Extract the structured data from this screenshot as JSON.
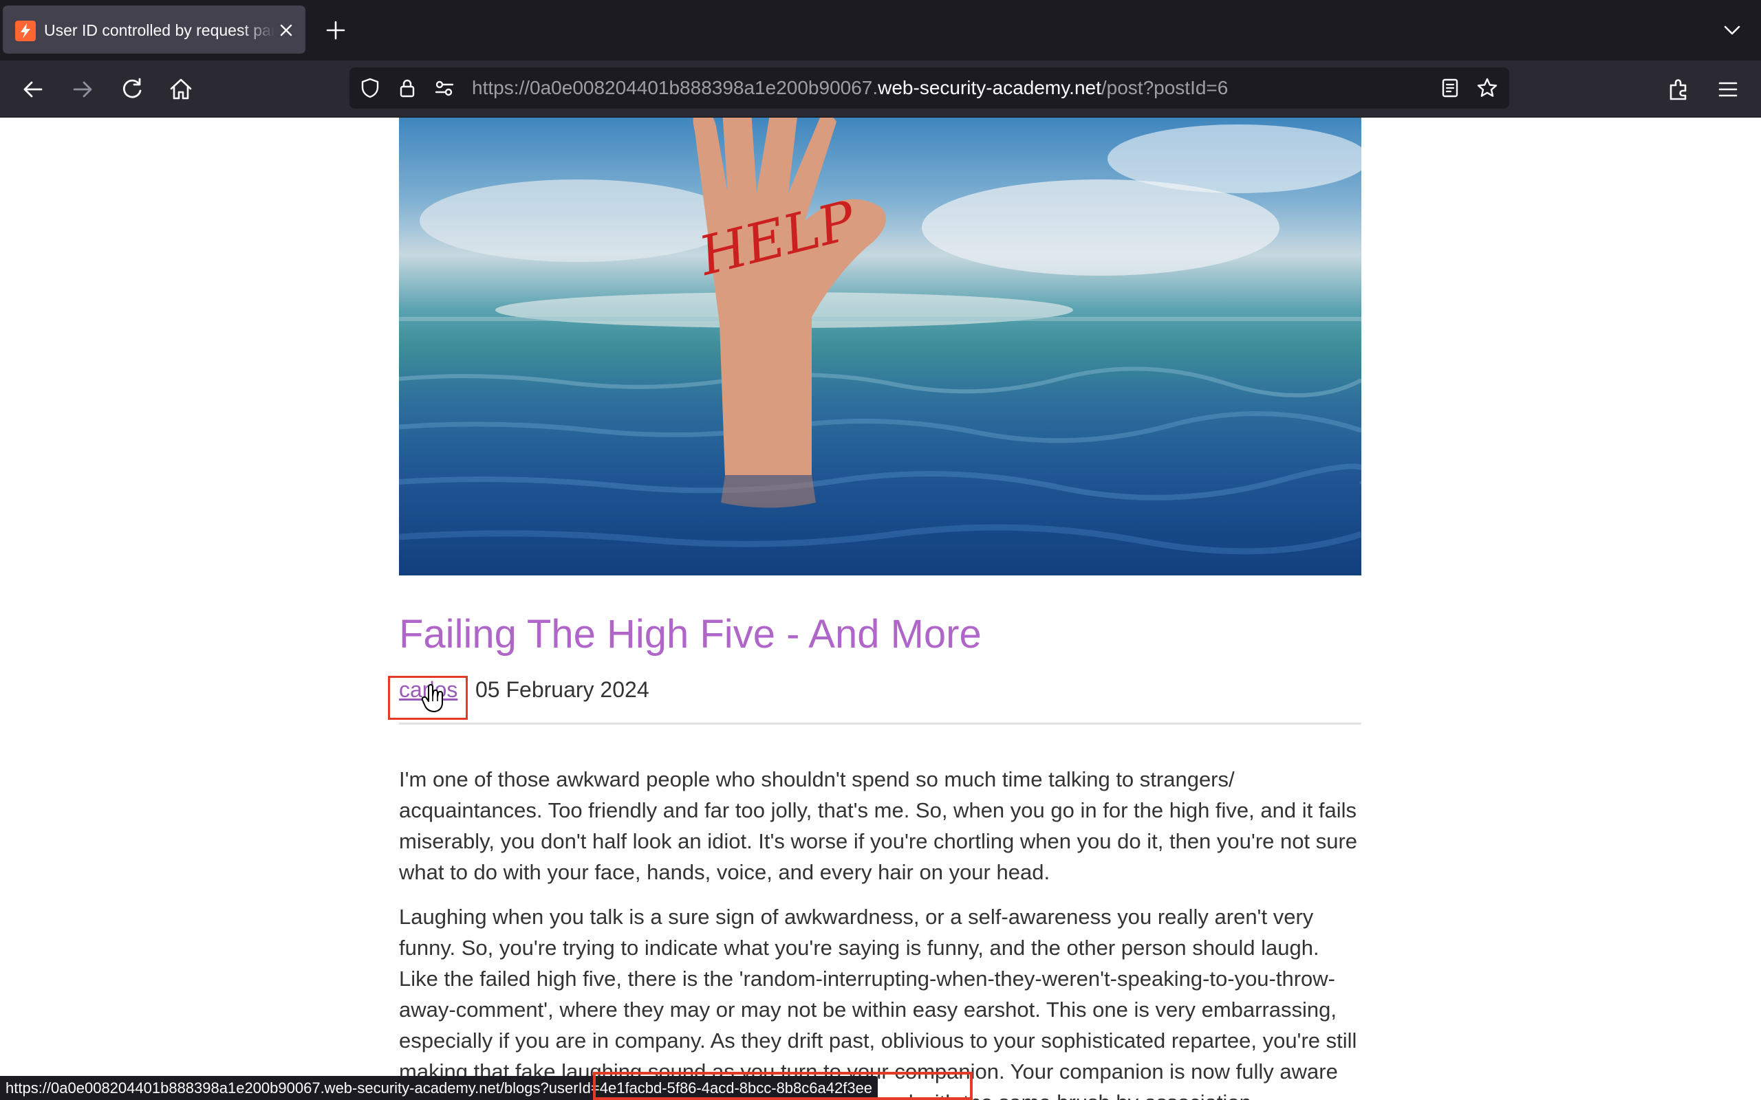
{
  "browser": {
    "tab": {
      "title": "User ID controlled by request parameter, with unpredictable user IDs"
    },
    "url": {
      "prefix": "https://0a0e008204401b888398a1e200b90067.",
      "domain": "web-security-academy.net",
      "path": "/post?postId=6"
    },
    "icons": [
      "back-icon",
      "forward-icon",
      "reload-icon",
      "home-icon",
      "shield-icon",
      "lock-icon",
      "permissions-icon",
      "reader-view-icon",
      "bookmark-star-icon",
      "extensions-icon",
      "menu-icon",
      "new-tab-icon",
      "tab-list-icon",
      "close-icon"
    ]
  },
  "post": {
    "hero_image_text": "HELP",
    "title": "Failing The High Five - And More",
    "author": "carlos",
    "date": "05 February 2024",
    "paragraphs": [
      "I'm one of those awkward people who shouldn't spend so much time talking to strangers/ acquaintances. Too friendly and far too jolly, that's me. So, when you go in for the high five, and it fails miserably, you don't half look an idiot. It's worse if you're chortling when you do it, then you're not sure what to do with your face, hands, voice, and every hair on your head.",
      "Laughing when you talk is a sure sign of awkwardness, or a self-awareness you really aren't very funny. So, you're trying to indicate what you're saying is funny, and the other person should laugh. Like the failed high five, there is the 'random-interrupting-when-they-weren't-speaking-to-you-throw-away-comment', where they may or may not be within easy earshot. This one is very embarrassing, especially if you are in company. As they drift past, oblivious to your sophisticated repartee, you're still making that fake laughing sound as you turn to your companion. Your companion is now fully aware you're one of those people, and therefore you're tarred with the same brush by association."
    ]
  },
  "status_bar": {
    "url": "https://0a0e008204401b888398a1e200b90067.web-security-academy.net/blogs?userId=4e1facbd-5f86-4acd-8bcc-8b8c6a42f3ee"
  },
  "colors": {
    "title": "#b066c8",
    "link": "#9a5ab9",
    "highlight": "#e53929",
    "favicon": "#ff6633"
  }
}
